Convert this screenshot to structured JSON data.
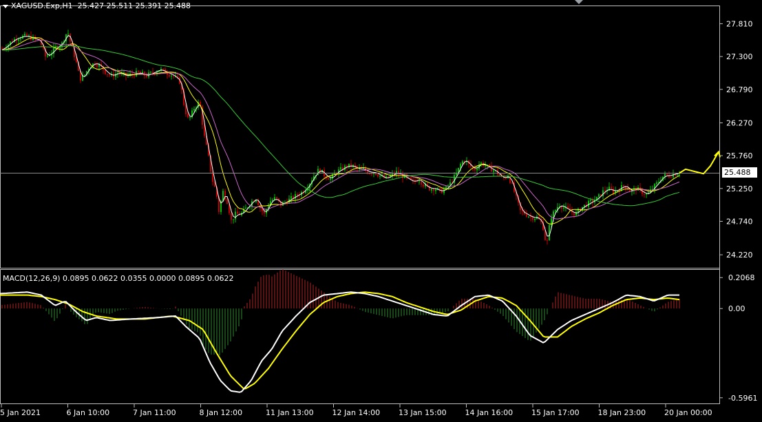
{
  "header": {
    "symbol": "XAGUSD.Exp,H1",
    "ohlc": "25.427 25.511 25.391 25.488"
  },
  "price_tag": "25.488",
  "macd_label": "MACD(12,26,9) 0.0895 0.0622 0.0355 0.0000 0.0895 0.0622",
  "colors": {
    "background": "#000000",
    "bull": "#00c000",
    "bear": "#c00000",
    "ma_fast": "#ffffff",
    "ma_mid": "#ffff00",
    "ma_slow": "#cc66cc",
    "ma_long": "#33cc33",
    "macd_line": "#ffffff",
    "signal_line": "#ffff00",
    "annotation": "#ffff00"
  },
  "chart_data": [
    {
      "type": "candlestick",
      "symbol": "XAGUSD.Exp",
      "timeframe": "H1",
      "y_ticks": [
        "27.810",
        "27.300",
        "26.790",
        "26.270",
        "25.760",
        "25.250",
        "24.740",
        "24.220"
      ],
      "x_ticks": [
        "5 Jan 2021",
        "6 Jan 10:00",
        "7 Jan 11:00",
        "8 Jan 12:00",
        "11 Jan 13:00",
        "12 Jan 14:00",
        "13 Jan 15:00",
        "14 Jan 16:00",
        "15 Jan 17:00",
        "18 Jan 23:00",
        "20 Jan 00:00"
      ],
      "ylim": [
        24.05,
        28.05
      ],
      "current_price": 25.488,
      "close_path": [
        [
          0,
          27.4
        ],
        [
          8,
          27.45
        ],
        [
          18,
          27.55
        ],
        [
          28,
          27.6
        ],
        [
          38,
          27.62
        ],
        [
          48,
          27.58
        ],
        [
          58,
          27.55
        ],
        [
          66,
          27.3
        ],
        [
          74,
          27.35
        ],
        [
          82,
          27.45
        ],
        [
          90,
          27.5
        ],
        [
          98,
          27.7
        ],
        [
          104,
          27.45
        ],
        [
          110,
          27.25
        ],
        [
          116,
          26.95
        ],
        [
          122,
          27.0
        ],
        [
          130,
          27.15
        ],
        [
          138,
          27.2
        ],
        [
          146,
          27.15
        ],
        [
          154,
          27.05
        ],
        [
          162,
          27.0
        ],
        [
          172,
          27.05
        ],
        [
          182,
          27.0
        ],
        [
          192,
          27.02
        ],
        [
          202,
          27.05
        ],
        [
          212,
          27.0
        ],
        [
          222,
          27.05
        ],
        [
          232,
          27.1
        ],
        [
          242,
          27.05
        ],
        [
          252,
          27.0
        ],
        [
          262,
          26.9
        ],
        [
          268,
          26.5
        ],
        [
          274,
          26.3
        ],
        [
          282,
          26.5
        ],
        [
          290,
          26.6
        ],
        [
          296,
          26.1
        ],
        [
          302,
          25.8
        ],
        [
          308,
          25.4
        ],
        [
          314,
          25.2
        ],
        [
          318,
          24.9
        ],
        [
          324,
          25.2
        ],
        [
          330,
          25.05
        ],
        [
          336,
          24.75
        ],
        [
          342,
          24.85
        ],
        [
          350,
          24.85
        ],
        [
          358,
          24.95
        ],
        [
          366,
          25.05
        ],
        [
          372,
          25.1
        ],
        [
          378,
          24.95
        ],
        [
          384,
          24.85
        ],
        [
          392,
          25.05
        ],
        [
          400,
          25.1
        ],
        [
          408,
          25.0
        ],
        [
          416,
          25.05
        ],
        [
          424,
          25.1
        ],
        [
          432,
          25.15
        ],
        [
          440,
          25.2
        ],
        [
          448,
          25.3
        ],
        [
          456,
          25.45
        ],
        [
          464,
          25.55
        ],
        [
          472,
          25.45
        ],
        [
          480,
          25.4
        ],
        [
          488,
          25.5
        ],
        [
          496,
          25.55
        ],
        [
          504,
          25.6
        ],
        [
          512,
          25.6
        ],
        [
          520,
          25.55
        ],
        [
          528,
          25.55
        ],
        [
          536,
          25.5
        ],
        [
          544,
          25.5
        ],
        [
          552,
          25.45
        ],
        [
          560,
          25.4
        ],
        [
          568,
          25.45
        ],
        [
          576,
          25.5
        ],
        [
          584,
          25.45
        ],
        [
          592,
          25.4
        ],
        [
          600,
          25.35
        ],
        [
          608,
          25.4
        ],
        [
          616,
          25.3
        ],
        [
          624,
          25.25
        ],
        [
          632,
          25.25
        ],
        [
          640,
          25.2
        ],
        [
          648,
          25.25
        ],
        [
          656,
          25.35
        ],
        [
          664,
          25.5
        ],
        [
          670,
          25.65
        ],
        [
          676,
          25.7
        ],
        [
          682,
          25.6
        ],
        [
          690,
          25.55
        ],
        [
          698,
          25.65
        ],
        [
          706,
          25.6
        ],
        [
          714,
          25.55
        ],
        [
          722,
          25.5
        ],
        [
          730,
          25.4
        ],
        [
          738,
          25.45
        ],
        [
          744,
          25.3
        ],
        [
          750,
          25.1
        ],
        [
          756,
          24.9
        ],
        [
          764,
          24.85
        ],
        [
          772,
          24.8
        ],
        [
          780,
          24.8
        ],
        [
          788,
          24.7
        ],
        [
          794,
          24.35
        ],
        [
          800,
          24.8
        ],
        [
          806,
          24.9
        ],
        [
          812,
          25.0
        ],
        [
          820,
          24.95
        ],
        [
          828,
          24.9
        ],
        [
          836,
          24.85
        ],
        [
          844,
          24.95
        ],
        [
          852,
          25.0
        ],
        [
          860,
          25.05
        ],
        [
          868,
          25.1
        ],
        [
          876,
          25.2
        ],
        [
          884,
          25.25
        ],
        [
          892,
          25.2
        ],
        [
          900,
          25.25
        ],
        [
          908,
          25.3
        ],
        [
          916,
          25.2
        ],
        [
          924,
          25.25
        ],
        [
          932,
          25.2
        ],
        [
          940,
          25.15
        ],
        [
          948,
          25.25
        ],
        [
          956,
          25.35
        ],
        [
          964,
          25.45
        ],
        [
          972,
          25.45
        ],
        [
          980,
          25.48
        ],
        [
          987,
          25.488
        ]
      ],
      "moving_averages": [
        {
          "color_key": "ma_fast",
          "offset": 1
        },
        {
          "color_key": "ma_mid",
          "offset": 5
        },
        {
          "color_key": "ma_slow",
          "offset": 9
        },
        {
          "color_key": "ma_long",
          "offset": 28
        }
      ],
      "projection": [
        [
          987,
          25.49
        ],
        [
          996,
          25.55
        ],
        [
          1022,
          25.48
        ],
        [
          1032,
          25.6
        ],
        [
          1044,
          25.82
        ]
      ]
    },
    {
      "type": "macd",
      "params": [
        12,
        26,
        9
      ],
      "y_ticks": [
        "0.2068",
        "0.00",
        "-0.5961"
      ],
      "ylim": [
        -0.62,
        0.24
      ],
      "macd_path": [
        [
          0,
          0.1
        ],
        [
          40,
          0.11
        ],
        [
          60,
          0.09
        ],
        [
          80,
          0.02
        ],
        [
          95,
          0.05
        ],
        [
          110,
          -0.02
        ],
        [
          125,
          -0.08
        ],
        [
          140,
          -0.06
        ],
        [
          160,
          -0.08
        ],
        [
          190,
          -0.07
        ],
        [
          230,
          -0.06
        ],
        [
          255,
          -0.05
        ],
        [
          270,
          -0.12
        ],
        [
          290,
          -0.2
        ],
        [
          305,
          -0.36
        ],
        [
          320,
          -0.48
        ],
        [
          335,
          -0.55
        ],
        [
          350,
          -0.56
        ],
        [
          365,
          -0.48
        ],
        [
          380,
          -0.35
        ],
        [
          395,
          -0.27
        ],
        [
          410,
          -0.15
        ],
        [
          430,
          -0.05
        ],
        [
          450,
          0.04
        ],
        [
          470,
          0.09
        ],
        [
          490,
          0.1
        ],
        [
          510,
          0.11
        ],
        [
          530,
          0.1
        ],
        [
          550,
          0.08
        ],
        [
          570,
          0.05
        ],
        [
          590,
          0.02
        ],
        [
          610,
          -0.01
        ],
        [
          630,
          -0.04
        ],
        [
          650,
          -0.05
        ],
        [
          670,
          0.02
        ],
        [
          690,
          0.08
        ],
        [
          710,
          0.09
        ],
        [
          730,
          0.05
        ],
        [
          750,
          -0.05
        ],
        [
          770,
          -0.18
        ],
        [
          790,
          -0.23
        ],
        [
          810,
          -0.14
        ],
        [
          830,
          -0.08
        ],
        [
          850,
          -0.04
        ],
        [
          870,
          0.0
        ],
        [
          890,
          0.04
        ],
        [
          910,
          0.09
        ],
        [
          930,
          0.08
        ],
        [
          950,
          0.05
        ],
        [
          970,
          0.09
        ],
        [
          987,
          0.09
        ]
      ],
      "signal_path": [
        [
          0,
          0.09
        ],
        [
          40,
          0.09
        ],
        [
          60,
          0.08
        ],
        [
          80,
          0.06
        ],
        [
          100,
          0.03
        ],
        [
          120,
          -0.02
        ],
        [
          140,
          -0.05
        ],
        [
          170,
          -0.07
        ],
        [
          210,
          -0.07
        ],
        [
          250,
          -0.05
        ],
        [
          275,
          -0.08
        ],
        [
          295,
          -0.14
        ],
        [
          315,
          -0.3
        ],
        [
          335,
          -0.45
        ],
        [
          355,
          -0.54
        ],
        [
          370,
          -0.5
        ],
        [
          390,
          -0.4
        ],
        [
          410,
          -0.27
        ],
        [
          430,
          -0.15
        ],
        [
          450,
          -0.04
        ],
        [
          470,
          0.04
        ],
        [
          490,
          0.08
        ],
        [
          510,
          0.1
        ],
        [
          530,
          0.11
        ],
        [
          550,
          0.1
        ],
        [
          570,
          0.08
        ],
        [
          590,
          0.04
        ],
        [
          610,
          0.01
        ],
        [
          630,
          -0.02
        ],
        [
          650,
          -0.04
        ],
        [
          670,
          -0.01
        ],
        [
          690,
          0.05
        ],
        [
          710,
          0.08
        ],
        [
          730,
          0.07
        ],
        [
          750,
          0.02
        ],
        [
          770,
          -0.08
        ],
        [
          790,
          -0.19
        ],
        [
          810,
          -0.19
        ],
        [
          830,
          -0.12
        ],
        [
          850,
          -0.07
        ],
        [
          870,
          -0.03
        ],
        [
          890,
          0.02
        ],
        [
          910,
          0.06
        ],
        [
          930,
          0.07
        ],
        [
          950,
          0.06
        ],
        [
          970,
          0.07
        ],
        [
          987,
          0.06
        ]
      ]
    }
  ]
}
